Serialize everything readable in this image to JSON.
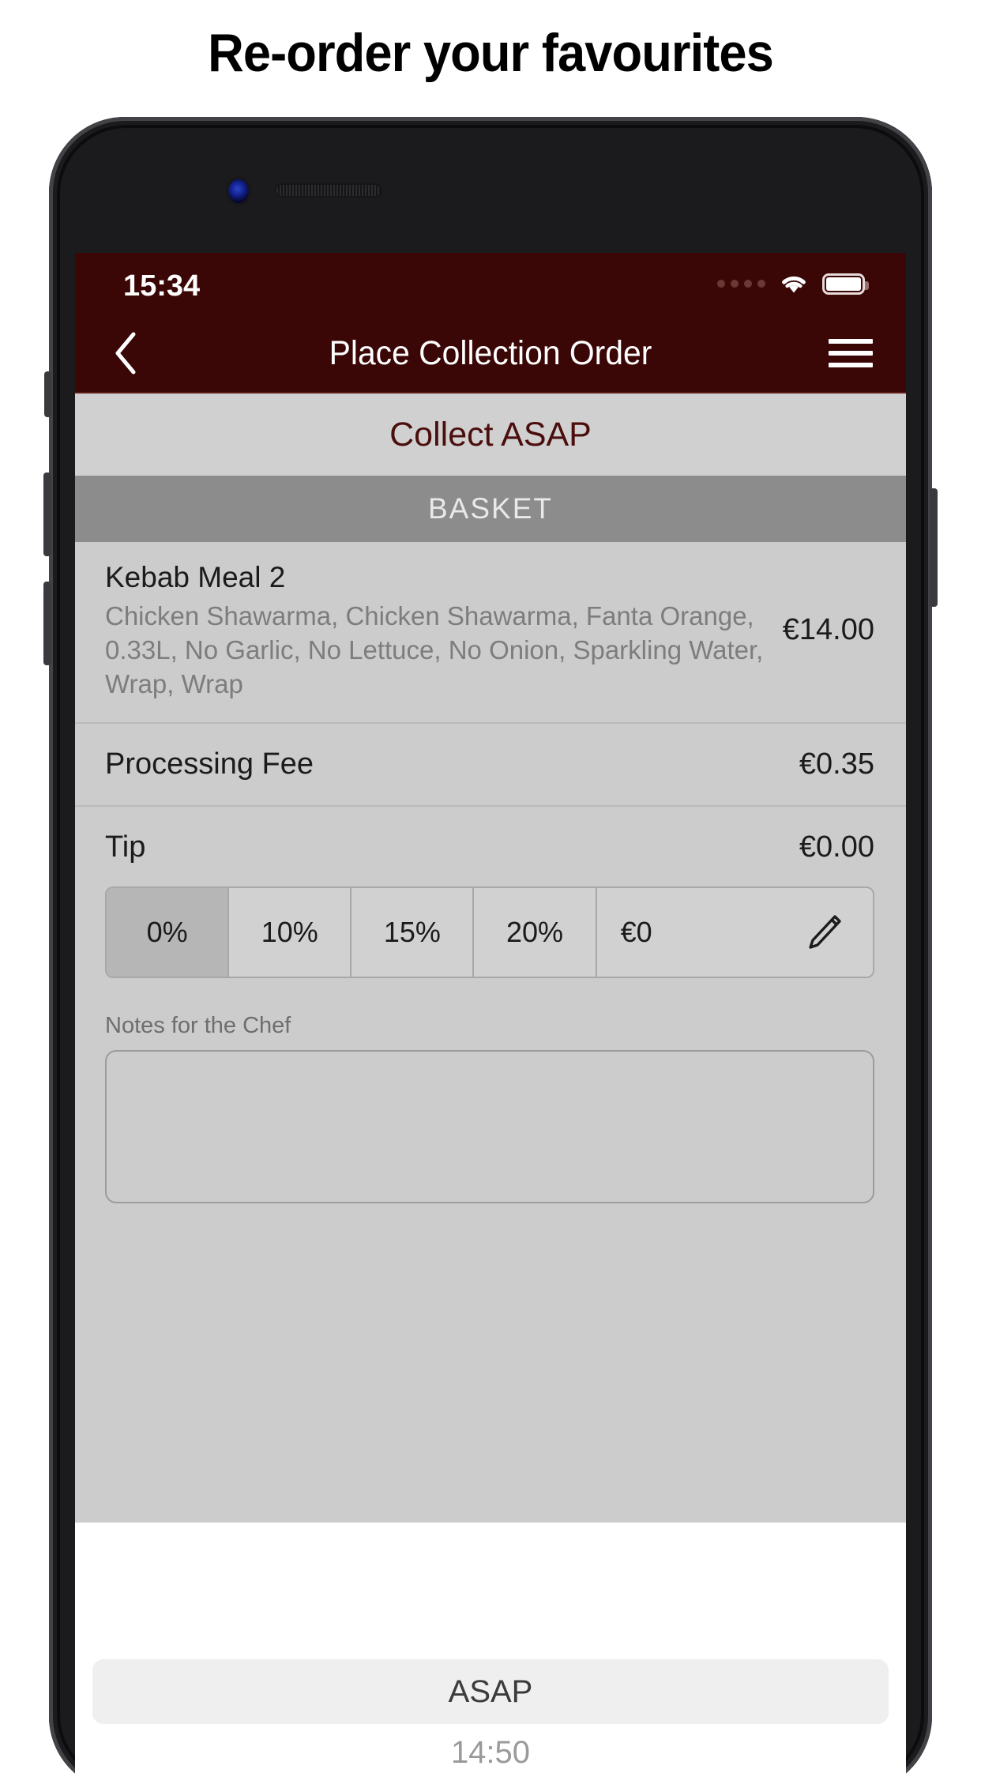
{
  "headline": "Re-order your favourites",
  "status_bar": {
    "time": "15:34",
    "signal_icon": "signal-dots-icon",
    "wifi_icon": "wifi-icon",
    "battery_icon": "battery-full-icon"
  },
  "navbar": {
    "back_icon": "chevron-left-icon",
    "title": "Place Collection Order",
    "menu_icon": "hamburger-menu-icon"
  },
  "bands": {
    "collect": "Collect ASAP",
    "basket": "BASKET"
  },
  "basket": {
    "items": [
      {
        "name": "Kebab Meal 2",
        "description": "Chicken Shawarma, Chicken Shawarma, Fanta Orange, 0.33L, No Garlic, No Lettuce, No Onion, Sparkling Water, Wrap, Wrap",
        "price": "€14.00"
      }
    ],
    "fees": [
      {
        "label": "Processing Fee",
        "value": "€0.35"
      },
      {
        "label": "Tip",
        "value": "€0.00"
      }
    ]
  },
  "tip_options": [
    {
      "label": "0%",
      "selected": true
    },
    {
      "label": "10%",
      "selected": false
    },
    {
      "label": "15%",
      "selected": false
    },
    {
      "label": "20%",
      "selected": false
    }
  ],
  "tip_custom": {
    "amount": "€0",
    "edit_icon": "pencil-icon"
  },
  "notes": {
    "label": "Notes for the Chef",
    "value": "",
    "placeholder": ""
  },
  "sheet": {
    "asap_label": "ASAP",
    "time": "14:50"
  },
  "colors": {
    "header_red": "#3a0706",
    "collect_band": "#d0d0d0",
    "basket_band": "#8c8c8c",
    "body_gray": "#cccccc",
    "selected_segment": "#b6b6b6",
    "collect_text": "#4a0e0c"
  }
}
